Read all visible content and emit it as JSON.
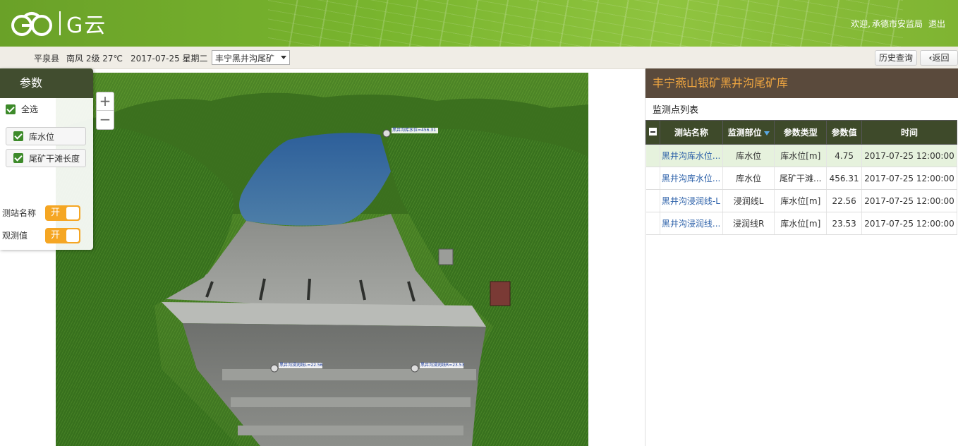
{
  "header": {
    "logo_text": "G云",
    "welcome": "欢迎,",
    "user": "承德市安监局",
    "logout": "退出"
  },
  "infobar": {
    "county": "平泉县",
    "weather": "南风 2级 27℃",
    "date": "2017-07-25 星期二",
    "site_select": "丰宁黑井沟尾矿",
    "history_btn": "历史查询",
    "back_btn": "返回"
  },
  "params": {
    "title": "参数",
    "select_all": "全选",
    "items": [
      "库水位",
      "尾矿干滩长度"
    ],
    "toggles": [
      {
        "label": "测站名称",
        "state": "开"
      },
      {
        "label": "观测值",
        "state": "开"
      }
    ]
  },
  "zoom": {
    "plus": "+",
    "minus": "−"
  },
  "scene_labels": {
    "pool": "黑井沟库水位=456.31",
    "left": "黑井沟浸润线L=22.56",
    "right": "黑井沟浸润线R=23.53"
  },
  "right_panel": {
    "title": "丰宁燕山银矿黑井沟尾矿库",
    "subtitle": "监测点列表",
    "columns": [
      "测站名称",
      "监测部位",
      "参数类型",
      "参数值",
      "时间"
    ],
    "rows": [
      {
        "name": "黑井沟库水位...",
        "part": "库水位",
        "type": "库水位[m]",
        "value": "4.75",
        "time": "2017-07-25 12:00:00"
      },
      {
        "name": "黑井沟库水位...",
        "part": "库水位",
        "type": "尾矿干滩...",
        "value": "456.31",
        "time": "2017-07-25 12:00:00"
      },
      {
        "name": "黑井沟浸润线-L",
        "part": "浸润线L",
        "type": "库水位[m]",
        "value": "22.56",
        "time": "2017-07-25 12:00:00"
      },
      {
        "name": "黑井沟浸润线...",
        "part": "浸润线R",
        "type": "库水位[m]",
        "value": "23.53",
        "time": "2017-07-25 12:00:00"
      }
    ]
  },
  "colors": {
    "header_green": "#79b52e",
    "dark_panel": "#414d2f",
    "title_brown": "#5a4a3c",
    "title_orange": "#f0a640",
    "toggle_orange": "#f5a623",
    "link_blue": "#2a5fa8"
  }
}
